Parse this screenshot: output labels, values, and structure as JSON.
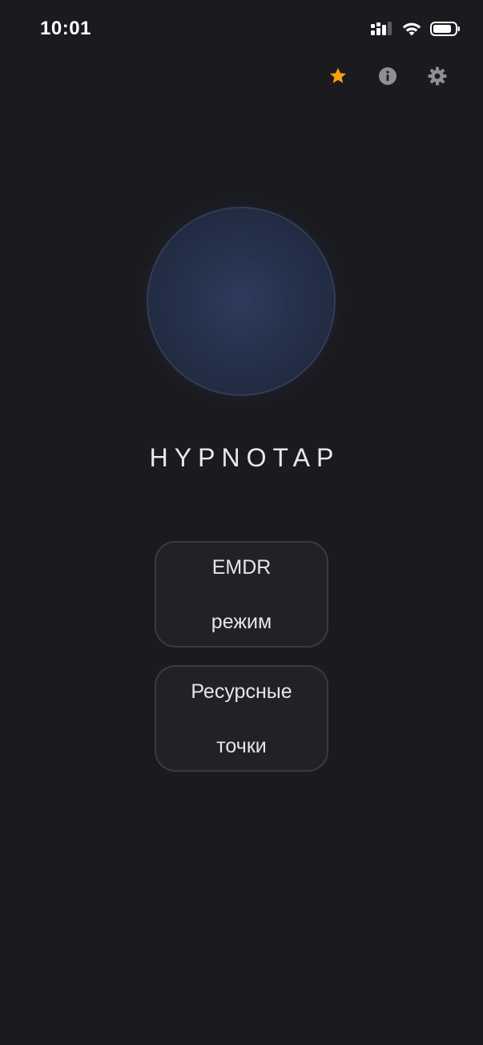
{
  "status_bar": {
    "time": "10:01"
  },
  "toolbar": {
    "icons": [
      "star-icon",
      "info-icon",
      "gear-icon"
    ],
    "favorite_color": "#f5a00f",
    "icon_color": "#8e8e93"
  },
  "app": {
    "title": "HYPNOTAP"
  },
  "buttons": {
    "emdr_line1": "EMDR",
    "emdr_line2": "режим",
    "resource_line1": "Ресурсные",
    "resource_line2": "точки"
  },
  "colors": {
    "background": "#1b1b1f",
    "orb": "#2e3b5c",
    "button_bg": "#222226",
    "button_border": "#3a3a40"
  }
}
